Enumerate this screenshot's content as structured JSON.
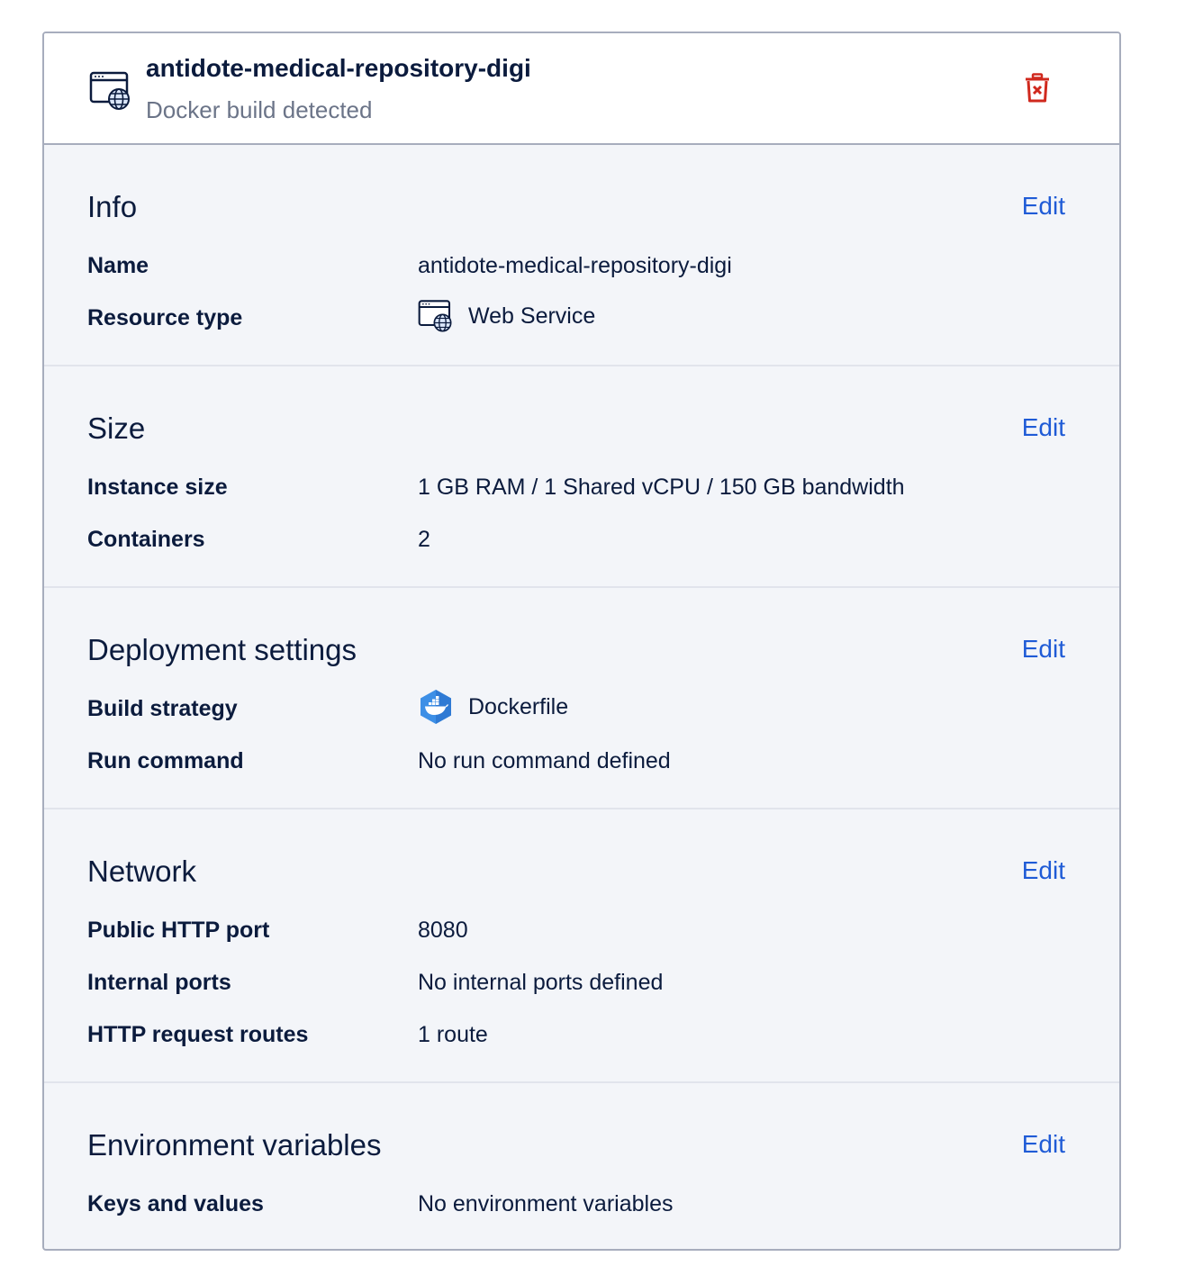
{
  "header": {
    "title": "antidote-medical-repository-digi",
    "subtitle": "Docker build detected",
    "icon": "web-service-icon",
    "delete_icon": "trash-icon",
    "delete_color": "#d0291e"
  },
  "colors": {
    "accent": "#1f5bd6",
    "text": "#0b1b3d",
    "muted": "#6b7488",
    "panel_bg": "#f3f5f9"
  },
  "sections": {
    "info": {
      "title": "Info",
      "edit": "Edit",
      "rows": [
        {
          "label": "Name",
          "value": "antidote-medical-repository-digi"
        },
        {
          "label": "Resource type",
          "value": "Web Service",
          "icon": "web-service-icon"
        }
      ]
    },
    "size": {
      "title": "Size",
      "edit": "Edit",
      "rows": [
        {
          "label": "Instance size",
          "value": "1 GB RAM / 1 Shared vCPU / 150 GB bandwidth"
        },
        {
          "label": "Containers",
          "value": "2"
        }
      ]
    },
    "deployment": {
      "title": "Deployment settings",
      "edit": "Edit",
      "rows": [
        {
          "label": "Build strategy",
          "value": "Dockerfile",
          "icon": "docker-icon"
        },
        {
          "label": "Run command",
          "value": "No run command defined"
        }
      ]
    },
    "network": {
      "title": "Network",
      "edit": "Edit",
      "rows": [
        {
          "label": "Public HTTP port",
          "value": "8080"
        },
        {
          "label": "Internal ports",
          "value": "No internal ports defined"
        },
        {
          "label": "HTTP request routes",
          "value": "1 route"
        }
      ]
    },
    "env": {
      "title": "Environment variables",
      "edit": "Edit",
      "rows": [
        {
          "label": "Keys and values",
          "value": "No environment variables"
        }
      ]
    }
  }
}
